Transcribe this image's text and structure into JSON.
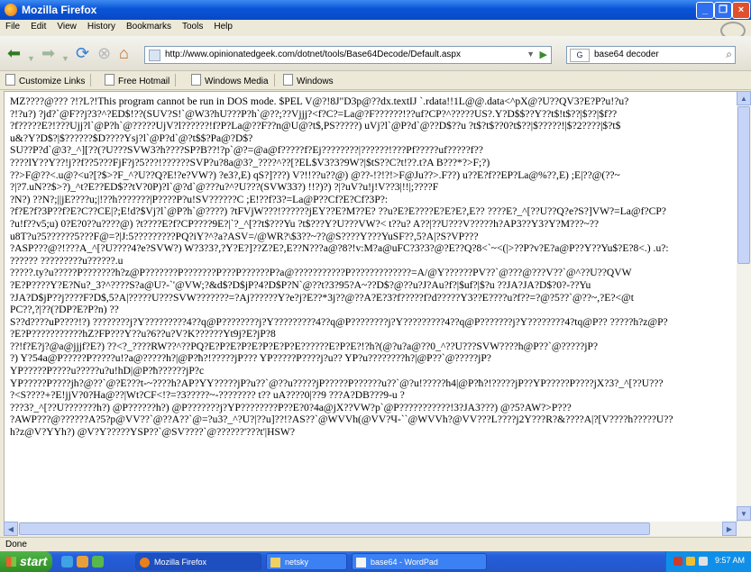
{
  "window": {
    "title": "Mozilla Firefox"
  },
  "menu": [
    "File",
    "Edit",
    "View",
    "History",
    "Bookmarks",
    "Tools",
    "Help"
  ],
  "nav": {
    "url": "http://www.opinionatedgeek.com/dotnet/tools/Base64Decode/Default.aspx",
    "search_engine": "G",
    "search_text": "base64 decoder"
  },
  "bookmarks": [
    "Customize Links",
    "Free Hotmail",
    "Windows Media",
    "Windows"
  ],
  "content_lines": [
    "MZ????@??? ?!?L?!This program cannot be run in DOS mode. $PEL V@?!8J\"D3p@??dx.textIJ `.rdata!!1L@@.data<^pX@?U??QV3?E?P?u!?u?",
    "?!?u?) ?jd?`@F??j?3?^?ED$!??(SUV?S!`@W3?hU???P?h`@??;??Vjjj?<f?C?=La@?F??????!??uf?CP?^?????US?.Y?D$$??Y??t$!t$??|$??|$f??",
    "?f?????E?!???Ujj?l`@P?h`@?????UjV?l??????!f?P?La@??F??n@U@?t$,PS?????) uVj?l`@P?d`@??D$??u ?t$?t$??0?t$??|$?????!|$?2????|$?t$",
    "u&?Y?D$?|$??????$D????Ysj?l`@P?d`@?t$$?Pa@?D$?",
    "SU??P?d`@3?_^][??(?U???SVW3?h????SP?B??!?p`@?=@a@f?????f?Ej????????|??????!???Pf?????uf?????f??",
    "????lY??Y??!j??f??5???FjF?j?5???!??????SVP?u?8a@3?_????^??[?EL$V3?3?9W?|$tS??C?t!??.t?A B???*?>F;?)",
    "??>F@??<.u@?<u?[?$>?F_^?U??Q?E!?e?VW?) ?e3?,E) qS?]???) V?!!??u??@) @??-!?!?!>F@Ju??>.F??) u??E?f??EP?La@%??,E) ;E|??@(??~",
    "?|?7.uN??$>?)_^t?E??ED$??tV?0P)?l`@?d`@???u?^?U???(SVW33?) !!?)?) ?|?uV?u!j!V??3|!!|;????F",
    "?N?) ??N?;||jE????u;|!??h???????|P????P?u!SV??????C ;E!??f?3?=La@P??Cf?E?Cf?3P?:",
    "?f?E?f?3P??f?E?C??CE|?;E!d?$Vj?l`@P?h`@????) ?tFVjW???!??????jEY??E?M??E? ??u?E?E????E?E?E?,E?? ????E?_^[??U??Q?e?S?]VW?=La@f?CP?",
    "?u!f??v5;u) 0?E?0??u????@) ?t????E?f?CP????9E?|`?_^[??t$???Yu ?t$???Y?U???VW?< t??u? A??|??U???V?????h?AP3??Y3?Y?M???~??",
    "u8T?u?5??????5???F@=?|J:5?????????PQ?iY?^?a?ASV=/@WR?\\$3??~??@S????Y???YuSF??,5?A|?S?VP???",
    "?ASP???@?!???A_^[?U????4?e?SVW?) W?3?3?,?Y?E?]??Z?E?,E??N???a@?8?!v:M?a@uFC?3?3?@?E??Q?8<`~<(|>??P?v?E?a@P??Y??Yu$?E?8<.) .u?:",
    "?????? ?????????u??????.u",
    "?????.ty?u?????P???????h?z@P???????P???????P???P??????P?a@???????????P?????????????=A/@Y??????PV??`@???@???V??`@^??U??QVW",
    "?E?P????Y?E?Nu?_3?^????S?a@U?-`'@VW;?&d$?D$jP?4?D$P?N`@??t?3?95?A~??D$?@??u?J?Au?f?|$uf?|$?u ??JA?JA?D$?0?-??Yu",
    "?JA?D$jP??j????F?D$,5?A|?????U???SVW???????=?Aj??????Y?e?j?E??*3j??@??A?E?3?f?????f?d?????Y3??E????u?f??=?@?5??`@??~,?E?<@t",
    "PC??,?|??(?DP?E?P?n) ??",
    "S??d????uP????!?) ????????j?Y?????????4??q@P????????j?Y?????????4??q@P????????j?Y?????????4??q@P???????j?Y????????4?tq@P?? ?????h?z@P?",
    "?E?P???????????hZ?FP???Y??u?6??u?V?K??????Yt9j?E?jP?8",
    "??!f?E?j?@a@jjjf?E?) ??<?_????RW??^??PQ?E?P?E?P?E?P?E?P?E??????E?P?E?!?h?(@?u?a@??0_^??U???SVW????h@P??`@?????jP?",
    "?) Y?54a@P?????P?????u!?a@?????h?|@P?ħ?!?????jP??? YP?????P????j?u?? YP?u????????h?|@P??`@?????jP?",
    "YP?????P????u?????u?u!hD|@P?ħ??????jP?c",
    "YP?????P????jh?@??`@?E???t-~????h?AP?YY?????jP?u??`@??u?????jP?????P??????u??`@?u!?????h4|@P?ħ?!?????jP??YP?????P????jX?3?_^[??U???",
    "?<S????+?E!jjV?0?Ha@??|Wt?CF<!?=?3?????~-???????? t?? uA????0|??9 ???A?DB???9-u ?",
    "???3?_^[??U???????h?) @P??????h?) @P???????j?YP????????P??E?0?4a@jX??VW?p`@P???????????!3?JA3???) @?5?AW?>P???",
    "?AWP???@??????A?5?p@VV??`@??A??`@=?u3?_^?U?|??u]??!?AS??`@WVVh(@VV?Ч-``@WVVh?@VV???L????j2Y???R?&????A|?[V????h?????U??",
    "h?z@V?YYh?) @V?Y?????YSP??`@SV????`@??????'???t'|HSW?"
  ],
  "status": "Done",
  "taskbar": {
    "start": "start",
    "tasks": [
      "Mozilla Firefox",
      "netsky",
      "base64 - WordPad"
    ],
    "clock": "9:57 AM"
  }
}
